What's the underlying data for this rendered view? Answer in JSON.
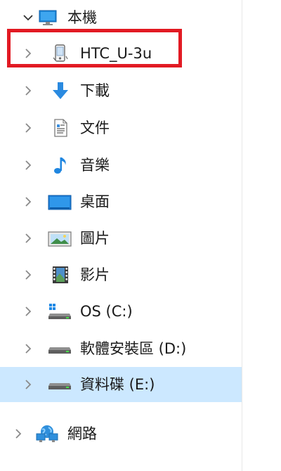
{
  "tree": {
    "this_pc": {
      "label": "本機",
      "icon": "monitor-icon",
      "state": "expanded"
    },
    "items": [
      {
        "label": "HTC_U-3u",
        "icon": "phone-device-icon",
        "highlighted": true
      },
      {
        "label": "下載",
        "icon": "download-arrow-icon"
      },
      {
        "label": "文件",
        "icon": "document-icon"
      },
      {
        "label": "音樂",
        "icon": "music-note-icon"
      },
      {
        "label": "桌面",
        "icon": "desktop-icon"
      },
      {
        "label": "圖片",
        "icon": "picture-icon"
      },
      {
        "label": "影片",
        "icon": "video-film-icon"
      },
      {
        "label": "OS (C:)",
        "icon": "windows-drive-icon"
      },
      {
        "label": "軟體安裝區 (D:)",
        "icon": "drive-icon"
      },
      {
        "label": "資料碟 (E:)",
        "icon": "drive-icon",
        "selected": true
      }
    ],
    "network": {
      "label": "網路",
      "icon": "network-icon"
    }
  },
  "colors": {
    "highlight_box": "#e21a23",
    "selection": "#cce8ff"
  }
}
